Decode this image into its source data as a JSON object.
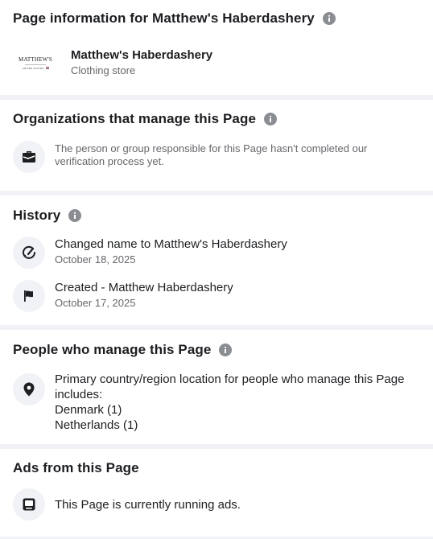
{
  "page_info": {
    "title": "Page information for Matthew's Haberdashery",
    "logo_text": "MATTHEW'S",
    "logo_subtext": "UNITED STATES",
    "name": "Matthew's Haberdashery",
    "category": "Clothing store"
  },
  "organizations": {
    "title": "Organizations that manage this Page",
    "message": "The person or group responsible for this Page hasn't completed our verification process yet."
  },
  "history": {
    "title": "History",
    "items": [
      {
        "icon": "rename-gauge-icon",
        "label": "Changed name to Matthew's Haberdashery",
        "date": "October 18, 2025"
      },
      {
        "icon": "flag-icon",
        "label": "Created - Matthew Haberdashery",
        "date": "October 17, 2025"
      }
    ]
  },
  "managers": {
    "title": "People who manage this Page",
    "intro": "Primary country/region location for people who manage this Page includes:",
    "countries": [
      "Denmark (1)",
      "Netherlands (1)"
    ]
  },
  "ads": {
    "title": "Ads from this Page",
    "message": "This Page is currently running ads."
  },
  "colors": {
    "background": "#f0f2f5",
    "secondary_text": "#65676b",
    "icon_dark": "#1c1e21",
    "info_icon": "#8a8d91"
  }
}
